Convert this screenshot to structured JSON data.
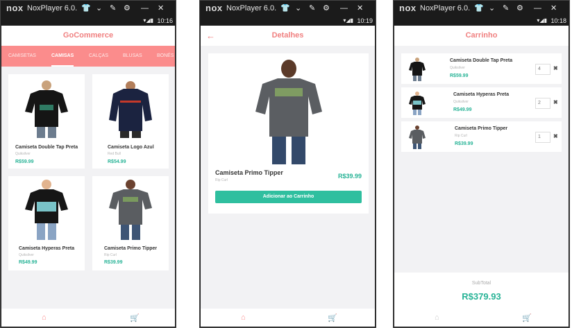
{
  "emulator": {
    "logo": "nox",
    "title": "NoxPlayer 6.0."
  },
  "screens": [
    {
      "clock": "10:16",
      "appbar_title": "GoCommerce",
      "tabs": [
        "CAMISETAS",
        "CAMISAS",
        "CALÇAS",
        "BLUSAS",
        "BONÉS"
      ],
      "active_tab": "CAMISAS",
      "products": [
        {
          "name": "Camiseta Double Tap Preta",
          "brand": "Quiksilver",
          "price": "R$59.99"
        },
        {
          "name": "Camiseta Logo Azul",
          "brand": "Red Bull",
          "price": "R$54.99"
        },
        {
          "name": "Camiseta Hyperas Preta",
          "brand": "Quiksilver",
          "price": "R$49.99"
        },
        {
          "name": "Camiseta Primo Tipper",
          "brand": "Rip Curl",
          "price": "R$39.99"
        }
      ]
    },
    {
      "clock": "10:19",
      "appbar_title": "Detalhes",
      "product": {
        "name": "Camiseta Primo Tipper",
        "brand": "Rip Curl",
        "price": "R$39.99"
      },
      "add_button": "Adicionar ao Carrinho"
    },
    {
      "clock": "10:18",
      "appbar_title": "Carrinho",
      "items": [
        {
          "name": "Camiseta Double Tap Preta",
          "brand": "Quiksilver",
          "price": "R$59.99",
          "qty": "4"
        },
        {
          "name": "Camiseta Hyperas Preta",
          "brand": "Quiksilver",
          "price": "R$49.99",
          "qty": "2"
        },
        {
          "name": "Camiseta Primo Tipper",
          "brand": "Rip Curl",
          "price": "R$39.99",
          "qty": "1"
        }
      ],
      "subtotal_label": "SubTotal",
      "subtotal_value": "R$379.93"
    }
  ],
  "colors": {
    "accent": "#fb8c8c",
    "price": "#27b396",
    "button": "#2fbf9f"
  },
  "icons": {
    "home": "home-icon",
    "cart": "cart-icon",
    "back": "back-arrow-icon",
    "remove": "close-icon"
  }
}
